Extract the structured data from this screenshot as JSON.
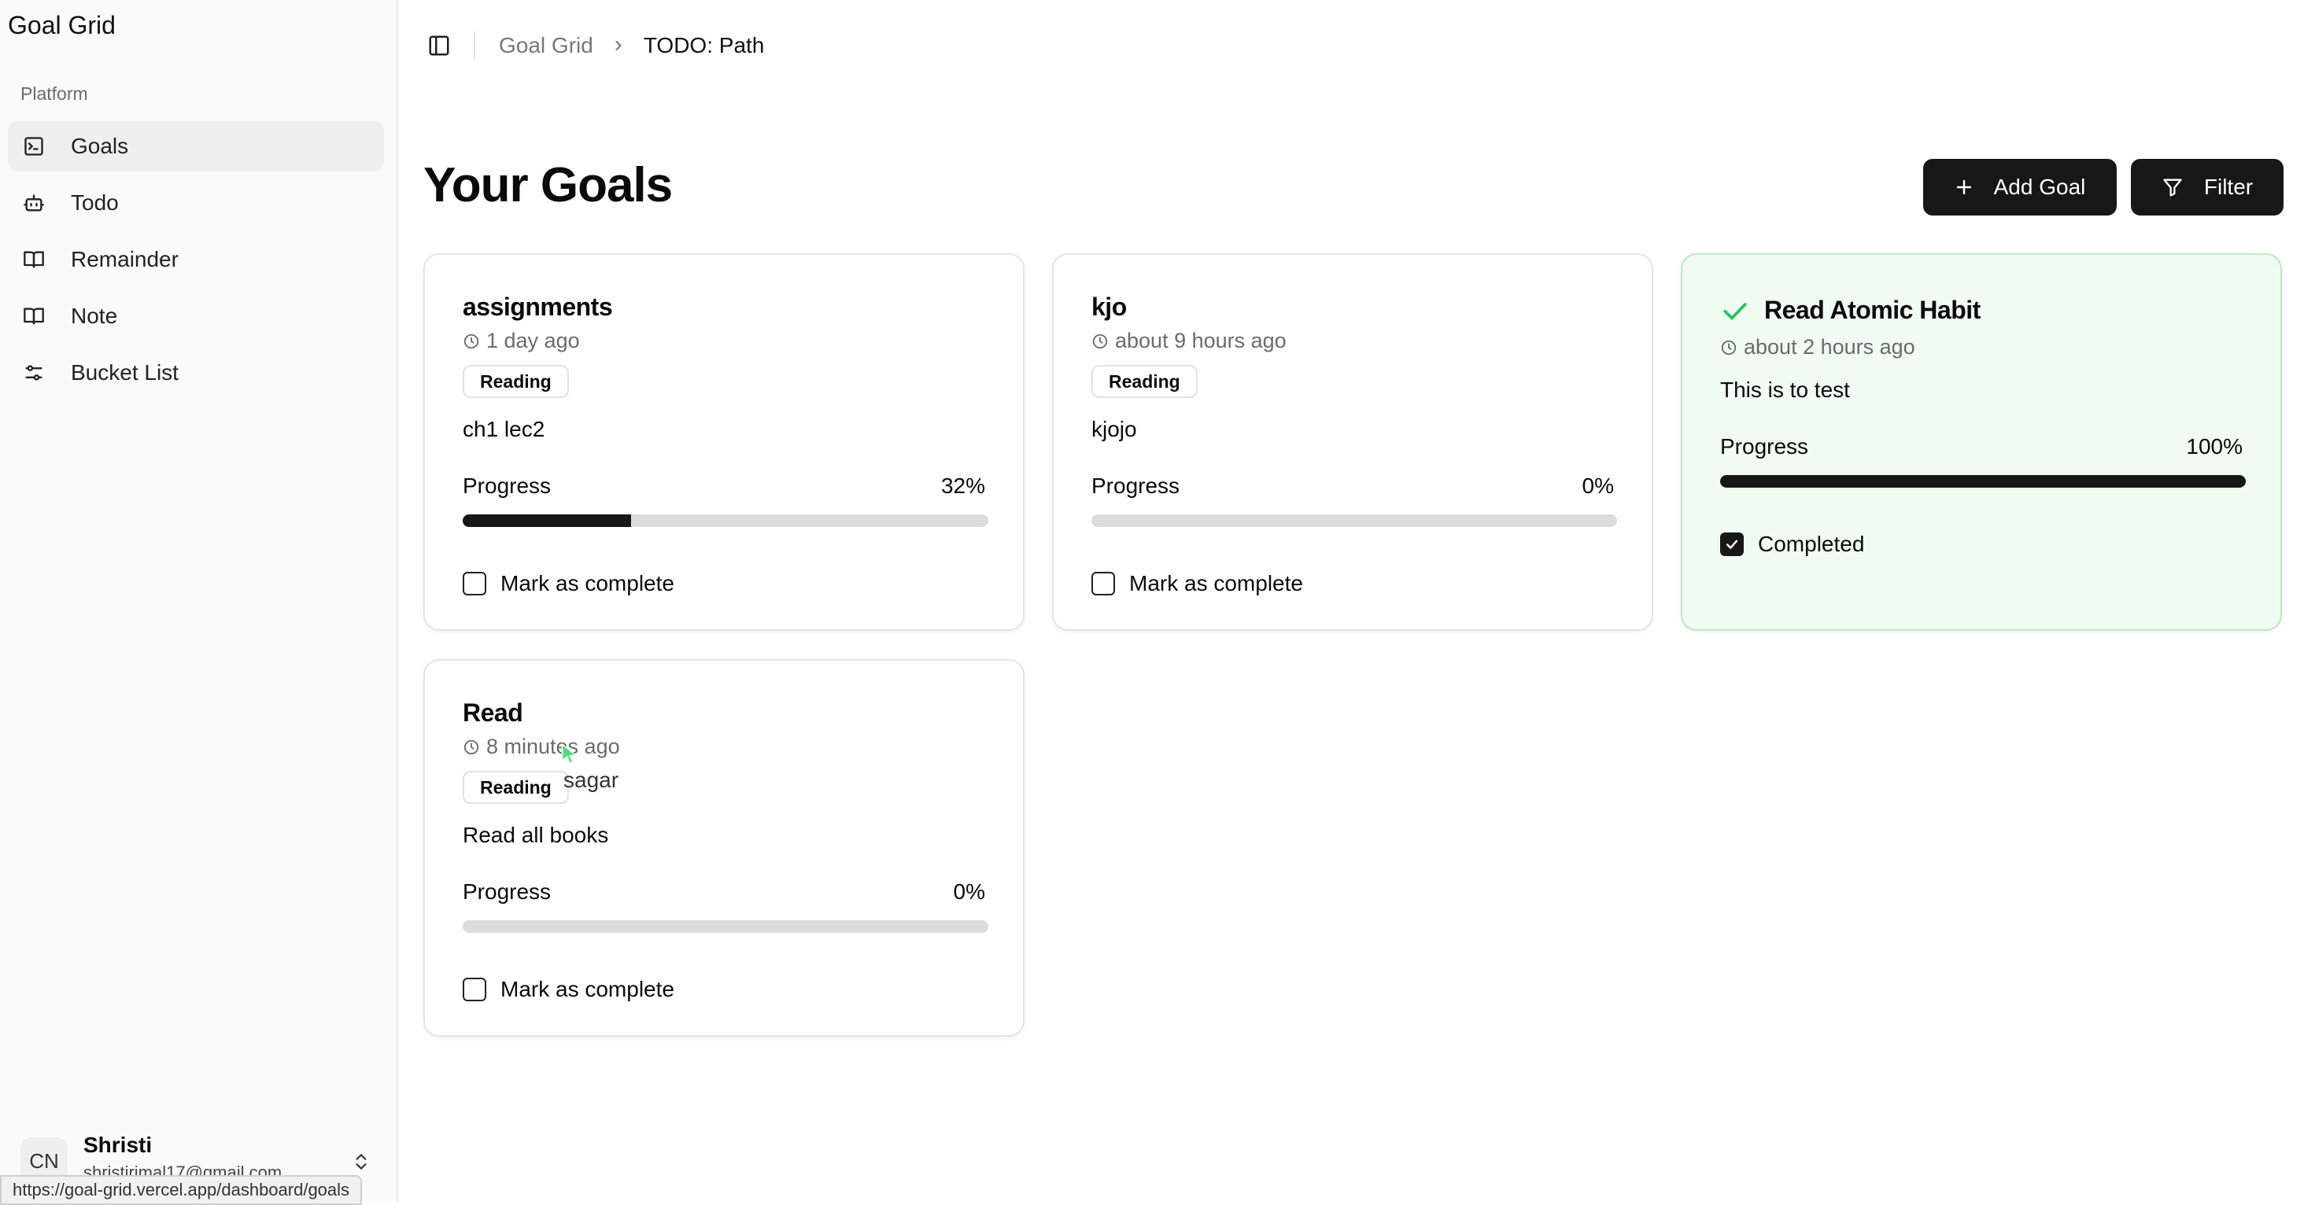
{
  "app": {
    "title": "Goal Grid"
  },
  "sidebar": {
    "group_label": "Platform",
    "items": [
      {
        "label": "Goals",
        "icon": "terminal-square-icon",
        "active": true
      },
      {
        "label": "Todo",
        "icon": "bot-icon",
        "active": false
      },
      {
        "label": "Remainder",
        "icon": "book-open-icon",
        "active": false
      },
      {
        "label": "Note",
        "icon": "book-open-icon",
        "active": false
      },
      {
        "label": "Bucket List",
        "icon": "sliders-icon",
        "active": false
      }
    ],
    "user": {
      "initials": "CN",
      "name": "Shristi",
      "email": "shristirimal17@gmail.com"
    }
  },
  "breadcrumb": {
    "root": "Goal Grid",
    "current": "TODO: Path"
  },
  "main": {
    "title": "Your Goals",
    "add_label": "Add Goal",
    "filter_label": "Filter"
  },
  "goals": [
    {
      "title": "assignments",
      "time": "1 day ago",
      "tag": "Reading",
      "description": "ch1 lec2",
      "progress_label": "Progress",
      "progress_text": "32%",
      "progress": 0.32,
      "check_label": "Mark as complete",
      "completed": false
    },
    {
      "title": "kjo",
      "time": "about 9 hours ago",
      "tag": "Reading",
      "description": "kjojo",
      "progress_label": "Progress",
      "progress_text": "0%",
      "progress": 0,
      "check_label": "Mark as complete",
      "completed": false
    },
    {
      "title": "Read Atomic Habit",
      "time": "about 2 hours ago",
      "description": "This is to test",
      "progress_label": "Progress",
      "progress_text": "100%",
      "progress": 1,
      "check_label": "Completed",
      "completed": true
    },
    {
      "title": "Read",
      "time": "8 minutes ago",
      "tag": "Reading",
      "description": "Read all books",
      "progress_label": "Progress",
      "progress_text": "0%",
      "progress": 0,
      "check_label": "Mark as complete",
      "completed": false
    }
  ],
  "cursor_label": "sagar",
  "status_url": "https://goal-grid.vercel.app/dashboard/goals",
  "colors": {
    "accent": "#171717",
    "success": "#22c55e",
    "done_bg": "#f0fbf2"
  }
}
